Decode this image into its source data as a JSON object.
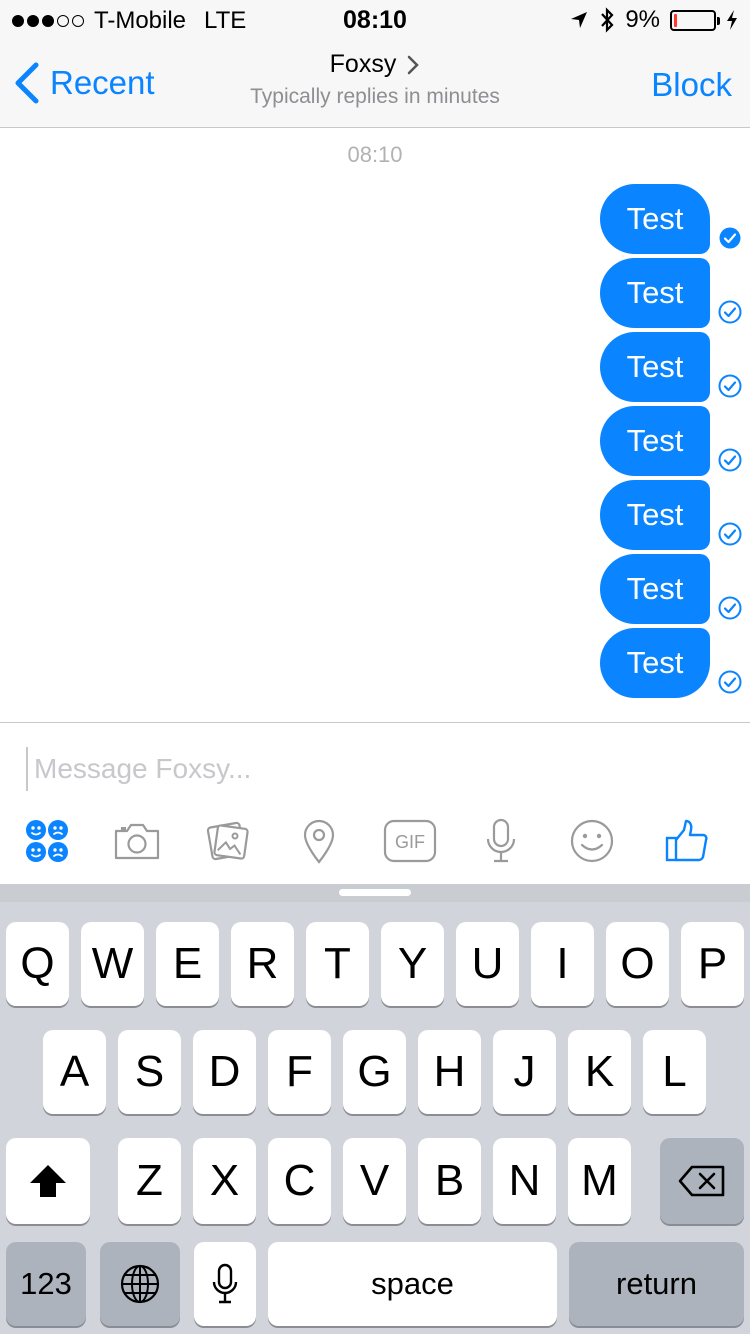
{
  "status_bar": {
    "carrier": "T-Mobile",
    "network": "LTE",
    "time": "08:10",
    "battery_percent": "9%",
    "battery_level": 0.09,
    "signal_bars_filled": 3,
    "signal_bars_total": 5,
    "icons": [
      "location-arrow-icon",
      "bluetooth-icon",
      "charging-bolt-icon"
    ]
  },
  "nav": {
    "back_label": "Recent",
    "title": "Foxsy",
    "subtitle": "Typically replies in minutes",
    "block_label": "Block"
  },
  "thread": {
    "timestamp": "08:10",
    "messages": [
      {
        "text": "Test",
        "receipt": "seen"
      },
      {
        "text": "Test",
        "receipt": "delivered"
      },
      {
        "text": "Test",
        "receipt": "delivered"
      },
      {
        "text": "Test",
        "receipt": "delivered"
      },
      {
        "text": "Test",
        "receipt": "delivered"
      },
      {
        "text": "Test",
        "receipt": "delivered"
      },
      {
        "text": "Test",
        "receipt": "delivered"
      }
    ]
  },
  "composer": {
    "placeholder": "Message Foxsy...",
    "value": "",
    "toolbar_icons": [
      "stickers-icon",
      "camera-icon",
      "gallery-icon",
      "location-icon",
      "gif-icon",
      "microphone-icon",
      "emoji-icon",
      "thumbs-up-icon"
    ],
    "gif_label": "GIF"
  },
  "keyboard": {
    "row1": [
      "Q",
      "W",
      "E",
      "R",
      "T",
      "Y",
      "U",
      "I",
      "O",
      "P"
    ],
    "row2": [
      "A",
      "S",
      "D",
      "F",
      "G",
      "H",
      "J",
      "K",
      "L"
    ],
    "row3": [
      "Z",
      "X",
      "C",
      "V",
      "B",
      "N",
      "M"
    ],
    "numbers_label": "123",
    "space_label": "space",
    "return_label": "return"
  },
  "colors": {
    "accent": "#0a84ff",
    "battery_low": "#ff3b30",
    "keyboard_bg": "#d1d5db",
    "key_dark": "#acb3bd"
  }
}
